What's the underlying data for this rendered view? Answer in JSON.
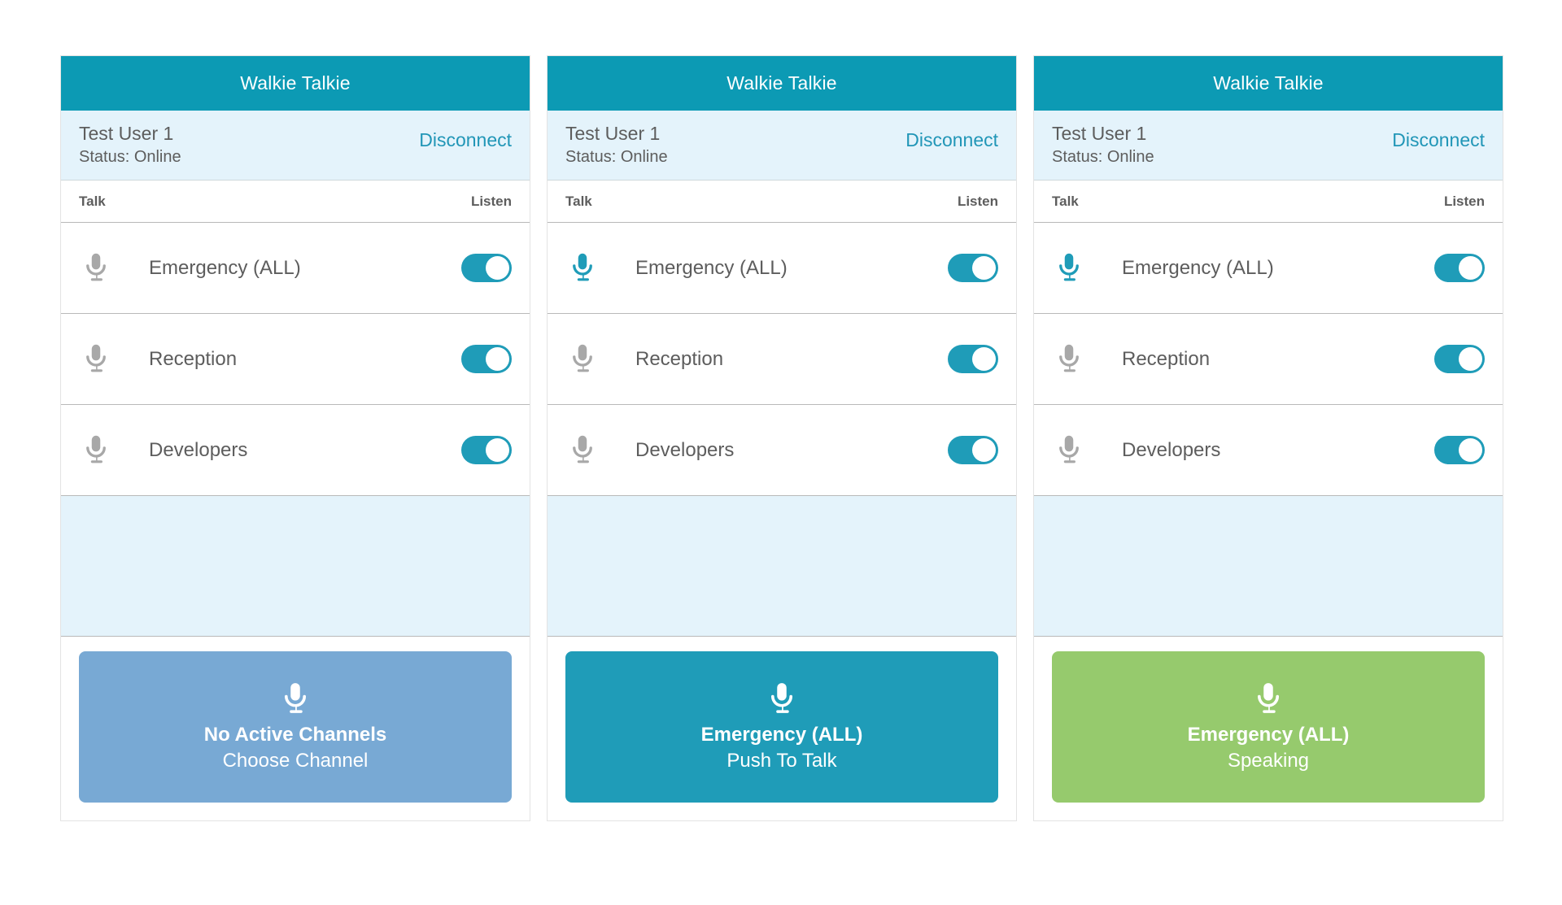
{
  "app": {
    "title": "Walkie Talkie",
    "colors": {
      "header_teal": "#0c9ab4",
      "link_teal": "#2196b7",
      "toggle_on": "#1f9cb8",
      "status_bg": "#e4f3fb",
      "ptt_idle_blue": "#78a9d4",
      "ptt_ready_teal": "#1f9cb8",
      "ptt_speaking_green": "#96ca6d",
      "mic_inactive_gray": "#a8a8a8",
      "mic_active_teal": "#1f9cb8",
      "text_gray": "#5d5d5d"
    }
  },
  "columns": {
    "talk_label": "Talk",
    "listen_label": "Listen"
  },
  "panels": [
    {
      "header_title": "Walkie Talkie",
      "user_name": "Test User 1",
      "user_status": "Status: Online",
      "disconnect_label": "Disconnect",
      "channels": [
        {
          "name": "Emergency (ALL)",
          "mic_icon": "microphone-icon",
          "mic_active": false,
          "listen_on": true
        },
        {
          "name": "Reception",
          "mic_icon": "microphone-icon",
          "mic_active": false,
          "listen_on": true
        },
        {
          "name": "Developers",
          "mic_icon": "microphone-icon",
          "mic_active": false,
          "listen_on": true
        }
      ],
      "ptt": {
        "icon": "microphone-icon",
        "title": "No Active Channels",
        "subtitle": "Choose Channel",
        "color": "#78a9d4",
        "state": "idle"
      }
    },
    {
      "header_title": "Walkie Talkie",
      "user_name": "Test User 1",
      "user_status": "Status: Online",
      "disconnect_label": "Disconnect",
      "channels": [
        {
          "name": "Emergency (ALL)",
          "mic_icon": "microphone-icon",
          "mic_active": true,
          "listen_on": true
        },
        {
          "name": "Reception",
          "mic_icon": "microphone-icon",
          "mic_active": false,
          "listen_on": true
        },
        {
          "name": "Developers",
          "mic_icon": "microphone-icon",
          "mic_active": false,
          "listen_on": true
        }
      ],
      "ptt": {
        "icon": "microphone-icon",
        "title": "Emergency (ALL)",
        "subtitle": "Push To Talk",
        "color": "#1f9cb8",
        "state": "ready"
      }
    },
    {
      "header_title": "Walkie Talkie",
      "user_name": "Test User 1",
      "user_status": "Status: Online",
      "disconnect_label": "Disconnect",
      "channels": [
        {
          "name": "Emergency (ALL)",
          "mic_icon": "microphone-icon",
          "mic_active": true,
          "listen_on": true
        },
        {
          "name": "Reception",
          "mic_icon": "microphone-icon",
          "mic_active": false,
          "listen_on": true
        },
        {
          "name": "Developers",
          "mic_icon": "microphone-icon",
          "mic_active": false,
          "listen_on": true
        }
      ],
      "ptt": {
        "icon": "microphone-icon",
        "title": "Emergency (ALL)",
        "subtitle": "Speaking",
        "color": "#96ca6d",
        "state": "speaking"
      }
    }
  ]
}
